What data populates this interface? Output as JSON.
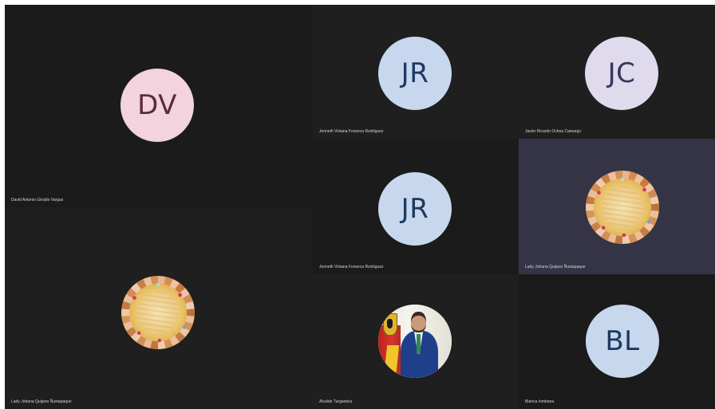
{
  "tiles": [
    {
      "name": "David Antonio Giraldo Vargas",
      "initials": "DV",
      "avatar_color": "#f2d3de",
      "type": "initials"
    },
    {
      "name": "Jenneth Viviana Fonseca Rodríguez",
      "initials": "JR",
      "avatar_color": "#c7d8ee",
      "type": "initials"
    },
    {
      "name": "Javier Ricardo Ochoa Camargo",
      "initials": "JC",
      "avatar_color": "#dfdaec",
      "type": "initials"
    },
    {
      "name": "Jenneth Viviana Fonseca Rodríguez",
      "initials": "JR",
      "avatar_color": "#c7d8ee",
      "type": "initials"
    },
    {
      "name": "Lady Johana Quijano Ñustapaque",
      "type": "photo",
      "photo": "hands-circle",
      "highlighted": true
    },
    {
      "name": "Lady Johana Quijano Ñustapaque",
      "type": "photo",
      "photo": "hands-circle"
    },
    {
      "name": "Alcalde Turgaetica",
      "type": "photo",
      "photo": "mayor-portrait"
    },
    {
      "name": "Blanca Iombana",
      "initials": "BL",
      "avatar_color": "#c7d8ee",
      "type": "initials"
    }
  ]
}
